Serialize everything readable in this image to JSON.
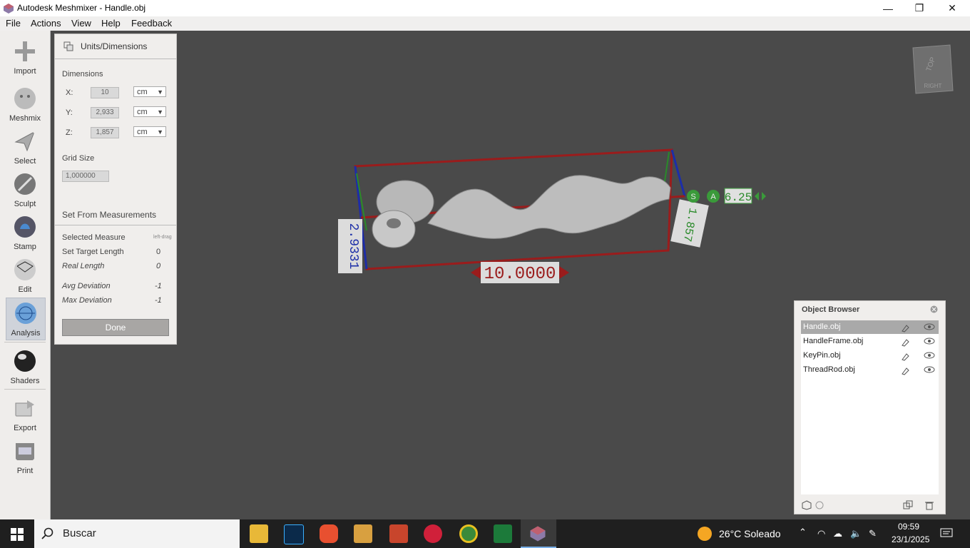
{
  "window": {
    "title": "Autodesk Meshmixer - Handle.obj",
    "minimize": "—",
    "maximize": "❐",
    "close": "✕"
  },
  "menu": [
    "File",
    "Actions",
    "View",
    "Help",
    "Feedback"
  ],
  "tools": [
    {
      "label": "Import",
      "icon": "import-icon"
    },
    {
      "label": "Meshmix",
      "icon": "meshmix-icon"
    },
    {
      "label": "Select",
      "icon": "select-icon"
    },
    {
      "label": "Sculpt",
      "icon": "sculpt-icon"
    },
    {
      "label": "Stamp",
      "icon": "stamp-icon"
    },
    {
      "label": "Edit",
      "icon": "edit-icon"
    },
    {
      "label": "Analysis",
      "icon": "analysis-icon"
    },
    {
      "label": "Shaders",
      "icon": "shaders-icon"
    },
    {
      "label": "Export",
      "icon": "export-icon"
    },
    {
      "label": "Print",
      "icon": "print-icon"
    }
  ],
  "panel": {
    "title": "Units/Dimensions",
    "dimensions_label": "Dimensions",
    "x_label": "X:",
    "x_value": "10",
    "x_unit": "cm",
    "y_label": "Y:",
    "y_value": "2,933",
    "y_unit": "cm",
    "z_label": "Z:",
    "z_value": "1,857",
    "z_unit": "cm",
    "grid_label": "Grid Size",
    "grid_value": "1,000000",
    "measure_section": "Set From Measurements",
    "selected_measure": "Selected Measure",
    "selected_measure_value": "left-drag",
    "target_length": "Set Target Length",
    "target_length_value": "0",
    "real_length": "Real Length",
    "real_length_value": "0",
    "avg_dev": "Avg Deviation",
    "avg_dev_value": "-1",
    "max_dev": "Max Deviation",
    "max_dev_value": "-1",
    "done": "Done"
  },
  "viewport": {
    "length_label": "10.0000",
    "height_label": "2.9331",
    "depth_label": "1.857",
    "scale_value": "6.25",
    "s_btn": "S",
    "a_btn": "A",
    "cube_top": "TOP",
    "cube_right": "RIGHT"
  },
  "object_browser": {
    "title": "Object Browser",
    "items": [
      "Handle.obj",
      "HandleFrame.obj",
      "KeyPin.obj",
      "ThreadRod.obj"
    ]
  },
  "taskbar": {
    "search": "Buscar",
    "weather": "26°C  Soleado",
    "time": "09:59",
    "date": "23/1/2025"
  }
}
